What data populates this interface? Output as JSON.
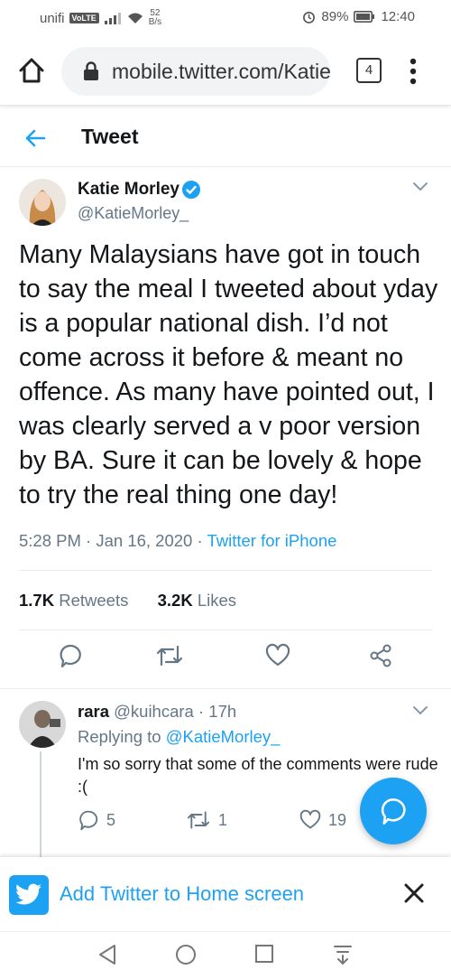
{
  "status_bar": {
    "carrier": "unifi",
    "volte": "VoLTE",
    "speed_value": "52",
    "speed_unit": "B/s",
    "battery": "89%",
    "time": "12:40"
  },
  "browser": {
    "url": "mobile.twitter.com/Katie",
    "tab_count": "4"
  },
  "page": {
    "title": "Tweet"
  },
  "tweet": {
    "author_name": "Katie Morley",
    "author_handle": "@KatieMorley_",
    "text": "Many Malaysians have got in touch to say the meal I tweeted about yday is a popular national dish. I’d not come across it before & meant no offence. As many have pointed out, I was clearly served a v poor version by BA. Sure it can be lovely & hope to try the real thing one day!",
    "time": "5:28 PM",
    "date": "Jan 16, 2020",
    "source": "Twitter for iPhone",
    "retweets_count": "1.7K",
    "retweets_label": "Retweets",
    "likes_count": "3.2K",
    "likes_label": "Likes"
  },
  "reply": {
    "name": "rara",
    "handle": "@kuihcara",
    "time": "17h",
    "replying_prefix": "Replying to",
    "replying_to": "@KatieMorley_",
    "text": "I'm so sorry that some of the comments were rude :(",
    "reply_count": "5",
    "retweet_count": "1",
    "like_count": "19"
  },
  "banner": {
    "text": "Add Twitter to Home screen"
  },
  "colors": {
    "accent": "#1da1f2",
    "secondary_text": "#657786",
    "divider": "#e6ecf0"
  }
}
